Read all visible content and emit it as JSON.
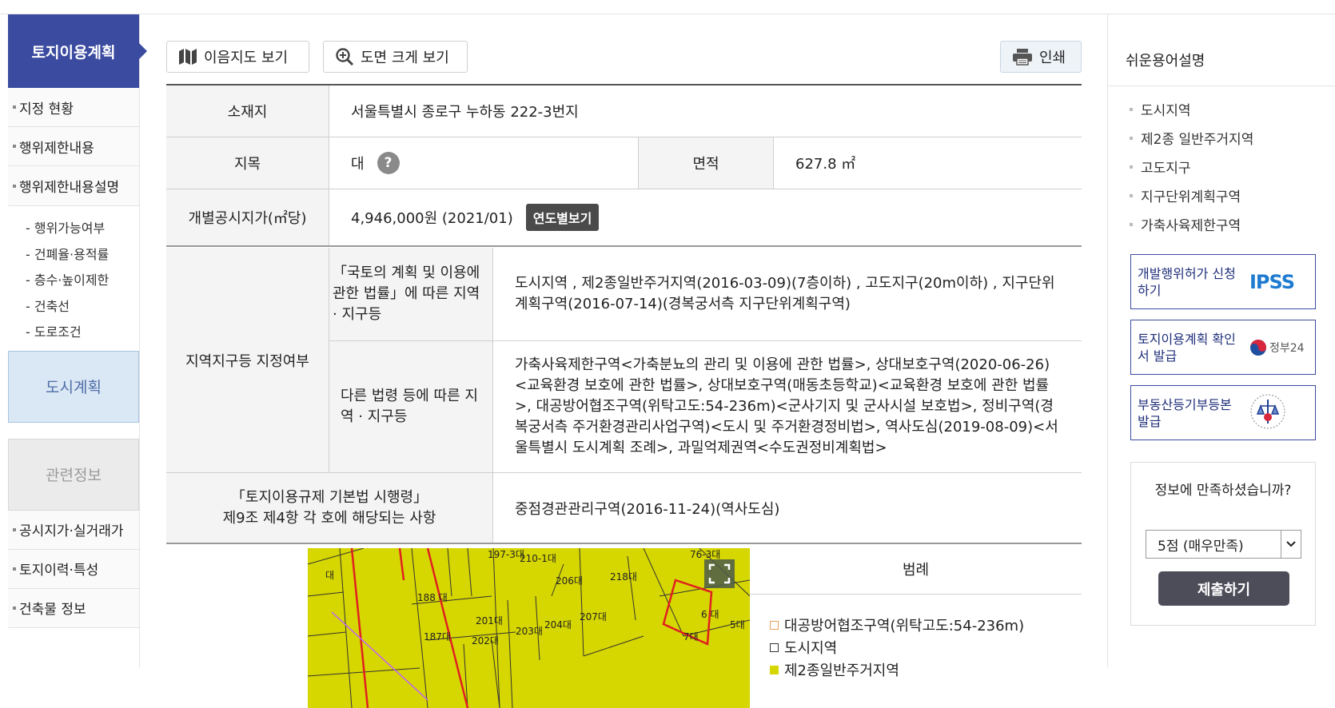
{
  "left_nav": {
    "header": "토지이용계획",
    "items_top": [
      "지정 현황",
      "행위제한내용",
      "행위제한내용설명"
    ],
    "sub_items": [
      "- 행위가능여부",
      "- 건폐율·용적률",
      "- 층수·높이제한",
      "- 건축선",
      "- 도로조건"
    ],
    "city_plan": "도시계획",
    "related_info": "관련정보",
    "items_bottom": [
      "공시지가·실거래가",
      "토지이력·특성",
      "건축물 정보"
    ]
  },
  "toolbar": {
    "map_view": "이음지도 보기",
    "zoom_view": "도면 크게 보기",
    "print": "인쇄"
  },
  "info": {
    "location_label": "소재지",
    "location_value": "서울특별시 종로구 누하동 222-3번지",
    "land_category_label": "지목",
    "land_category_value": "대",
    "help_mark": "?",
    "area_label": "면적",
    "area_value": "627.8 ㎡",
    "price_label": "개별공시지가(㎡당)",
    "price_value": "4,946,000원 (2021/01)",
    "price_year_button": "연도별보기",
    "zoning_label": "지역지구등 지정여부",
    "law1_label": "「국토의 계획 및 이용에 관한 법률」에 따른 지역 · 지구등",
    "law1_value": "도시지역 , 제2종일반주거지역(2016-03-09)(7층이하) , 고도지구(20m이하) , 지구단위계획구역(2016-07-14)(경복궁서측 지구단위계획구역)",
    "law2_label": "다른 법령 등에 따른 지역 · 지구등",
    "law2_value": "가축사육제한구역<가축분뇨의 관리 및 이용에 관한 법률>, 상대보호구역(2020-06-26)<교육환경 보호에 관한 법률>, 상대보호구역(매동초등학교)<교육환경 보호에 관한 법률>, 대공방어협조구역(위탁고도:54-236m)<군사기지 및 군사시설 보호법>, 정비구역(경복궁서측 주거환경관리사업구역)<도시 및 주거환경정비법>, 역사도심(2019-08-09)<서울특별시 도시계획 조례>, 과밀억제권역<수도권정비계획법>",
    "basic_law_label_line1": "「토지이용규제 기본법 시행령」",
    "basic_law_label_line2": "제9조 제4항 각 호에 해당되는 사항",
    "basic_law_value": "중점경관관리구역(2016-11-24)(역사도심)"
  },
  "map": {
    "parcel_labels": [
      "197-3대",
      "210-1대",
      "76-3대",
      "218대",
      "188 대",
      "201대",
      "203대",
      "204대",
      "207대",
      "187대",
      "202대",
      "6 대",
      "7대",
      "5대",
      "대",
      "206대"
    ]
  },
  "legend": {
    "title": "범례",
    "items": [
      {
        "label": "대공방어협조구역(위탁고도:54-236m)",
        "color": "#e8a060"
      },
      {
        "label": "도시지역",
        "color": "#333333"
      },
      {
        "label": "제2종일반주거지역",
        "color": "#d6d600"
      }
    ]
  },
  "right_sidebar": {
    "title": "쉬운용어설명",
    "terms": [
      "도시지역",
      "제2종 일반주거지역",
      "고도지구",
      "지구단위계획구역",
      "가축사육제한구역"
    ],
    "services": [
      {
        "label": "개발행위허가 신청하기",
        "logo": "IPSS"
      },
      {
        "label": "토지이용계획 확인서 발급",
        "logo": "정부24"
      },
      {
        "label": "부동산등기부등본 발급",
        "logo": ""
      }
    ],
    "survey_question": "정보에 만족하셨습니까?",
    "survey_selected": "5점 (매우만족)",
    "survey_submit": "제출하기"
  },
  "colors": {
    "brand_navy": "#3b4ba0",
    "map_yellow": "#d6d600",
    "zone_red": "#e02020"
  }
}
